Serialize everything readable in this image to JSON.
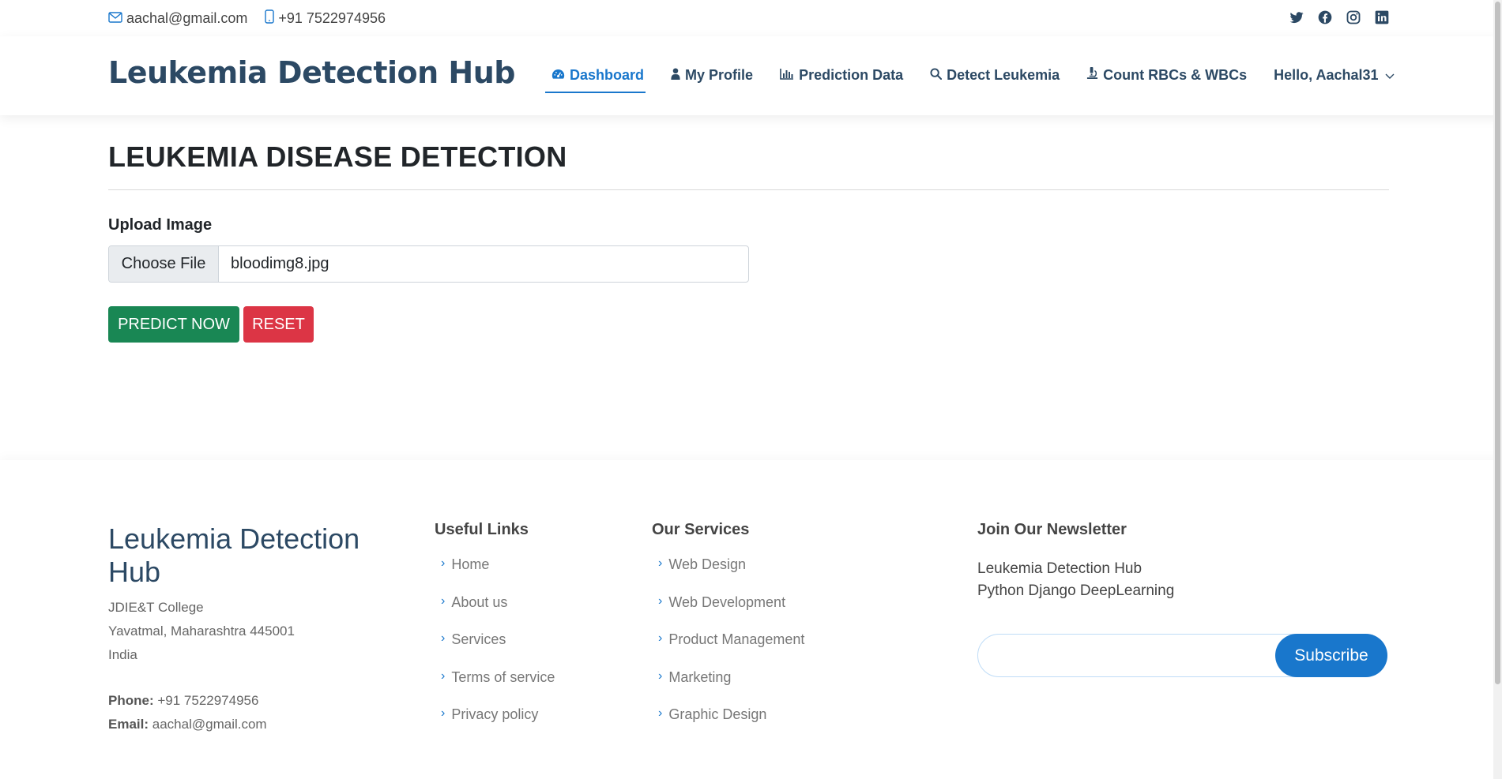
{
  "topbar": {
    "email": "aachal@gmail.com",
    "phone": "+91 7522974956",
    "social": [
      "twitter-icon",
      "facebook-icon",
      "instagram-icon",
      "linkedin-icon"
    ]
  },
  "header": {
    "logo": "Leukemia Detection Hub",
    "nav": [
      {
        "label": "Dashboard",
        "icon": "dashboard-icon",
        "active": true
      },
      {
        "label": "My Profile",
        "icon": "user-icon"
      },
      {
        "label": "Prediction Data",
        "icon": "bar-chart-icon"
      },
      {
        "label": "Detect Leukemia",
        "icon": "search-icon"
      },
      {
        "label": "Count RBCs & WBCs",
        "icon": "microscope-icon"
      }
    ],
    "user_menu": "Hello, Aachal31"
  },
  "main": {
    "title": "LEUKEMIA DISEASE DETECTION",
    "upload_label": "Upload Image",
    "choose_file": "Choose File",
    "file_name": "bloodimg8.jpg",
    "predict_label": "PREDICT NOW",
    "reset_label": "RESET"
  },
  "footer": {
    "brand": "Leukemia Detection Hub",
    "address": [
      "JDIE&T College",
      "Yavatmal, Maharashtra 445001",
      "India"
    ],
    "phone_label": "Phone:",
    "phone": "+91 7522974956",
    "email_label": "Email:",
    "email": "aachal@gmail.com",
    "useful_links": {
      "title": "Useful Links",
      "items": [
        "Home",
        "About us",
        "Services",
        "Terms of service",
        "Privacy policy"
      ]
    },
    "services": {
      "title": "Our Services",
      "items": [
        "Web Design",
        "Web Development",
        "Product Management",
        "Marketing",
        "Graphic Design"
      ]
    },
    "newsletter": {
      "title": "Join Our Newsletter",
      "line1": "Leukemia Detection Hub",
      "line2": "Python Django DeepLearning",
      "input_value": "",
      "button": "Subscribe"
    }
  },
  "colors": {
    "brand": "#2c4964",
    "accent": "#1977cc",
    "predict": "#198754",
    "reset": "#dc3545"
  }
}
